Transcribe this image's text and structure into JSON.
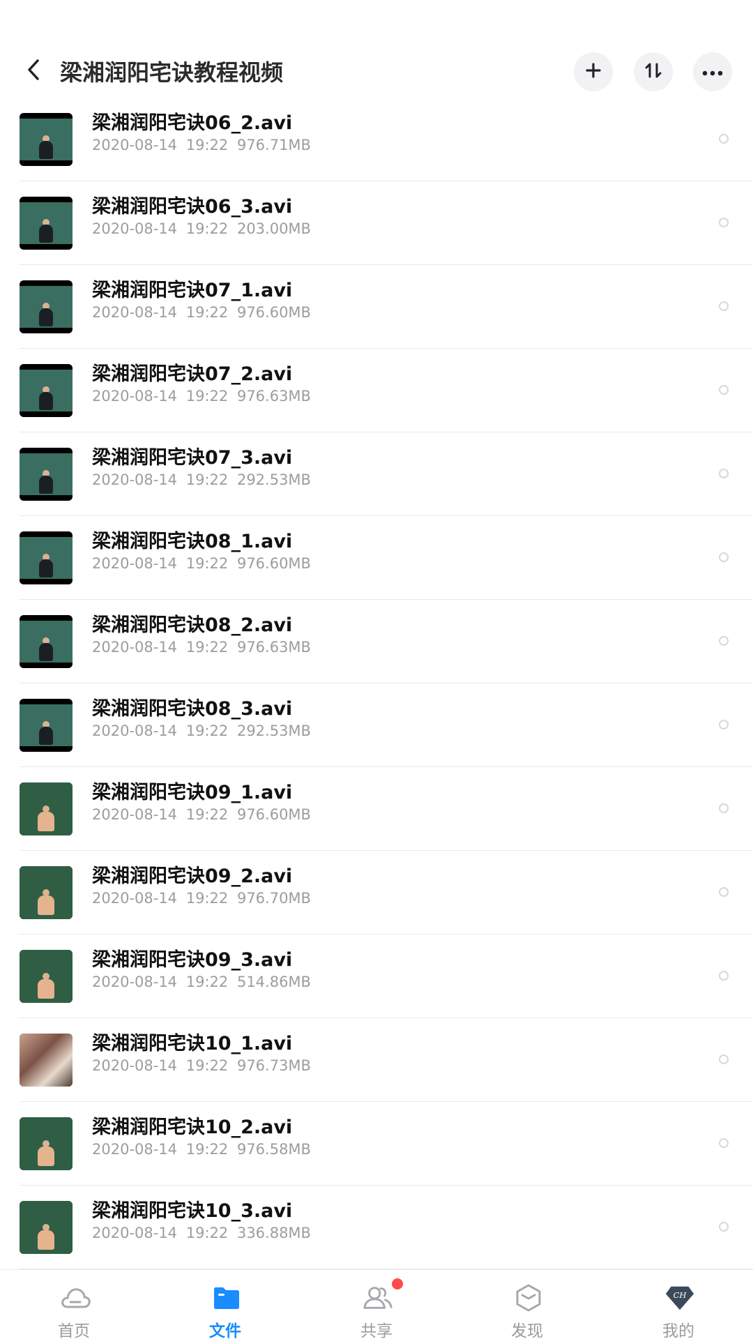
{
  "header": {
    "title": "梁湘润阳宅诀教程视频",
    "back_icon": "chevron-left-icon",
    "actions": [
      {
        "name": "add",
        "icon": "plus-icon"
      },
      {
        "name": "sort",
        "icon": "sort-arrows-icon"
      },
      {
        "name": "more",
        "icon": "more-dots-icon"
      }
    ]
  },
  "files": [
    {
      "name": "梁湘润阳宅诀06_2.avi",
      "date": "2020-08-14",
      "time": "19:22",
      "size": "976.71MB",
      "thumb": "chalkboard-wide"
    },
    {
      "name": "梁湘润阳宅诀06_3.avi",
      "date": "2020-08-14",
      "time": "19:22",
      "size": "203.00MB",
      "thumb": "chalkboard-wide"
    },
    {
      "name": "梁湘润阳宅诀07_1.avi",
      "date": "2020-08-14",
      "time": "19:22",
      "size": "976.60MB",
      "thumb": "chalkboard-wide"
    },
    {
      "name": "梁湘润阳宅诀07_2.avi",
      "date": "2020-08-14",
      "time": "19:22",
      "size": "976.63MB",
      "thumb": "chalkboard-wide"
    },
    {
      "name": "梁湘润阳宅诀07_3.avi",
      "date": "2020-08-14",
      "time": "19:22",
      "size": "292.53MB",
      "thumb": "chalkboard-wide"
    },
    {
      "name": "梁湘润阳宅诀08_1.avi",
      "date": "2020-08-14",
      "time": "19:22",
      "size": "976.60MB",
      "thumb": "chalkboard-wide"
    },
    {
      "name": "梁湘润阳宅诀08_2.avi",
      "date": "2020-08-14",
      "time": "19:22",
      "size": "976.63MB",
      "thumb": "chalkboard-wide"
    },
    {
      "name": "梁湘润阳宅诀08_3.avi",
      "date": "2020-08-14",
      "time": "19:22",
      "size": "292.53MB",
      "thumb": "chalkboard-wide"
    },
    {
      "name": "梁湘润阳宅诀09_1.avi",
      "date": "2020-08-14",
      "time": "19:22",
      "size": "976.60MB",
      "thumb": "chalkboard-full"
    },
    {
      "name": "梁湘润阳宅诀09_2.avi",
      "date": "2020-08-14",
      "time": "19:22",
      "size": "976.70MB",
      "thumb": "chalkboard-full"
    },
    {
      "name": "梁湘润阳宅诀09_3.avi",
      "date": "2020-08-14",
      "time": "19:22",
      "size": "514.86MB",
      "thumb": "chalkboard-full"
    },
    {
      "name": "梁湘润阳宅诀10_1.avi",
      "date": "2020-08-14",
      "time": "19:22",
      "size": "976.73MB",
      "thumb": "classroom-photo"
    },
    {
      "name": "梁湘润阳宅诀10_2.avi",
      "date": "2020-08-14",
      "time": "19:22",
      "size": "976.58MB",
      "thumb": "chalkboard-full"
    },
    {
      "name": "梁湘润阳宅诀10_3.avi",
      "date": "2020-08-14",
      "time": "19:22",
      "size": "336.88MB",
      "thumb": "chalkboard-full"
    }
  ],
  "tabbar": {
    "tabs": [
      {
        "label": "首页",
        "icon": "cloud-icon",
        "active": false
      },
      {
        "label": "文件",
        "icon": "folder-icon",
        "active": true
      },
      {
        "label": "共享",
        "icon": "people-icon",
        "active": false,
        "badge": true
      },
      {
        "label": "发现",
        "icon": "hexagon-icon",
        "active": false
      },
      {
        "label": "我的",
        "icon": "ch-avatar-icon",
        "active": false,
        "avatar_text": "CH"
      }
    ],
    "active_color": "#1a8cff",
    "badge_color": "#ff4b4b"
  }
}
